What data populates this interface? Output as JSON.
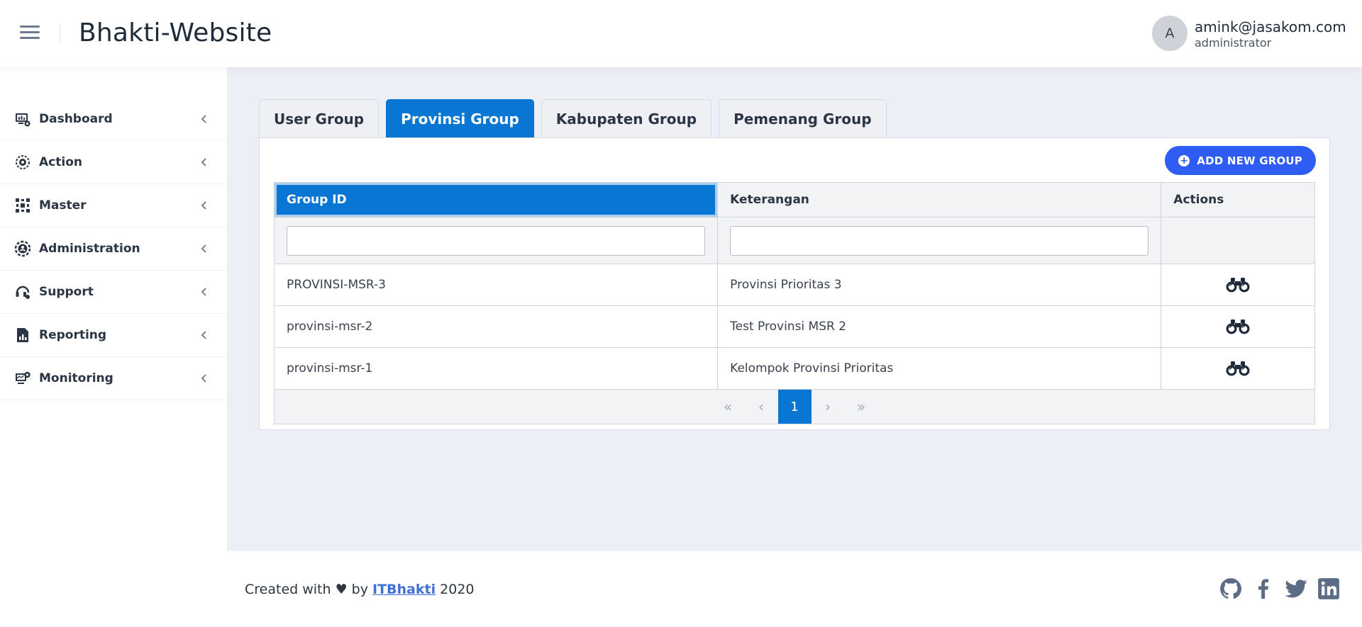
{
  "header": {
    "title": "Bhakti-Website",
    "user": {
      "avatar_initial": "A",
      "email": "amink@jasakom.com",
      "role": "administrator"
    }
  },
  "sidebar": {
    "items": [
      {
        "label": "Dashboard",
        "icon": "dashboard-icon"
      },
      {
        "label": "Action",
        "icon": "action-icon"
      },
      {
        "label": "Master",
        "icon": "master-icon"
      },
      {
        "label": "Administration",
        "icon": "administration-icon"
      },
      {
        "label": "Support",
        "icon": "support-icon"
      },
      {
        "label": "Reporting",
        "icon": "reporting-icon"
      },
      {
        "label": "Monitoring",
        "icon": "monitoring-icon"
      }
    ]
  },
  "tabs": [
    {
      "label": "User Group",
      "active": false
    },
    {
      "label": "Provinsi Group",
      "active": true
    },
    {
      "label": "Kabupaten Group",
      "active": false
    },
    {
      "label": "Pemenang Group",
      "active": false
    }
  ],
  "add_button_label": "ADD NEW GROUP",
  "table": {
    "columns": [
      "Group ID",
      "Keterangan",
      "Actions"
    ],
    "filters": {
      "group_id": "",
      "keterangan": ""
    },
    "rows": [
      {
        "group_id": "PROVINSI-MSR-3",
        "keterangan": "Provinsi Prioritas 3"
      },
      {
        "group_id": "provinsi-msr-2",
        "keterangan": "Test Provinsi MSR 2"
      },
      {
        "group_id": "provinsi-msr-1",
        "keterangan": "Kelompok Provinsi Prioritas"
      }
    ]
  },
  "pagination": {
    "first": "«",
    "prev": "‹",
    "current": "1",
    "next": "›",
    "last": "»"
  },
  "footer": {
    "prefix": "Created with ♥ by",
    "link": "ITBhakti",
    "year": "2020"
  },
  "colors": {
    "accent": "#0a76d3",
    "button": "#2f5cf2",
    "link": "#3f6fd8",
    "social": "#5b6c84"
  }
}
